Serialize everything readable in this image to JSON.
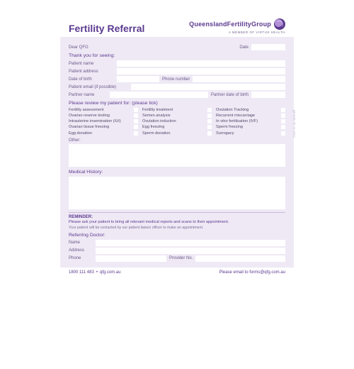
{
  "header": {
    "title": "Fertility Referral",
    "brand_name": "QueenslandFertilityGroup",
    "brand_sub": "A MEMBER OF VIRTUS HEALTH"
  },
  "salutation": "Dear QFG",
  "date_label": "Date",
  "sections": {
    "seeing": "Thank you for seeing:",
    "review": "Please review my patient for: (please tick)",
    "other": "Other:",
    "history": "Medical History:",
    "reminder_title": "REMINDER:",
    "reminder_line": "Please ask your patient to bring all relevant medical reports and scans to their appointment.",
    "reminder_sub": "Your patient will be contacted by our patient liaison officer to make an appointment.",
    "referring": "Referring Doctor:"
  },
  "labels": {
    "patient_name": "Patient name",
    "patient_address": "Patient address",
    "dob": "Date of birth",
    "phone": "Phone number",
    "email": "Patient email (if possible)",
    "partner_name": "Partner name",
    "partner_dob": "Partner date of birth",
    "name": "Name",
    "address": "Address",
    "dphone": "Phone",
    "provider": "Provider No."
  },
  "review_options": {
    "col1": [
      "Fertility assessment",
      "Ovarian reserve testing",
      "Intrauterine insemination (IUI)",
      "Ovarian tissue freezing",
      "Egg donation"
    ],
    "col2": [
      "Fertility treatment",
      "Semen analysis",
      "Ovulation induction",
      "Egg freezing",
      "Sperm donation"
    ],
    "col3": [
      "Ovulation Tracking",
      "Recurrent miscarriage",
      "In vitro fertilisation (IVF)",
      "Sperm freezing",
      "Surrogacy"
    ]
  },
  "footer": {
    "phone": "1800 111 483",
    "site": "qfg.com.au",
    "email_prefix": "Please email to ",
    "email": "forms@qfg.com.au"
  },
  "sidecode": "QFGGR 05.21.2021"
}
